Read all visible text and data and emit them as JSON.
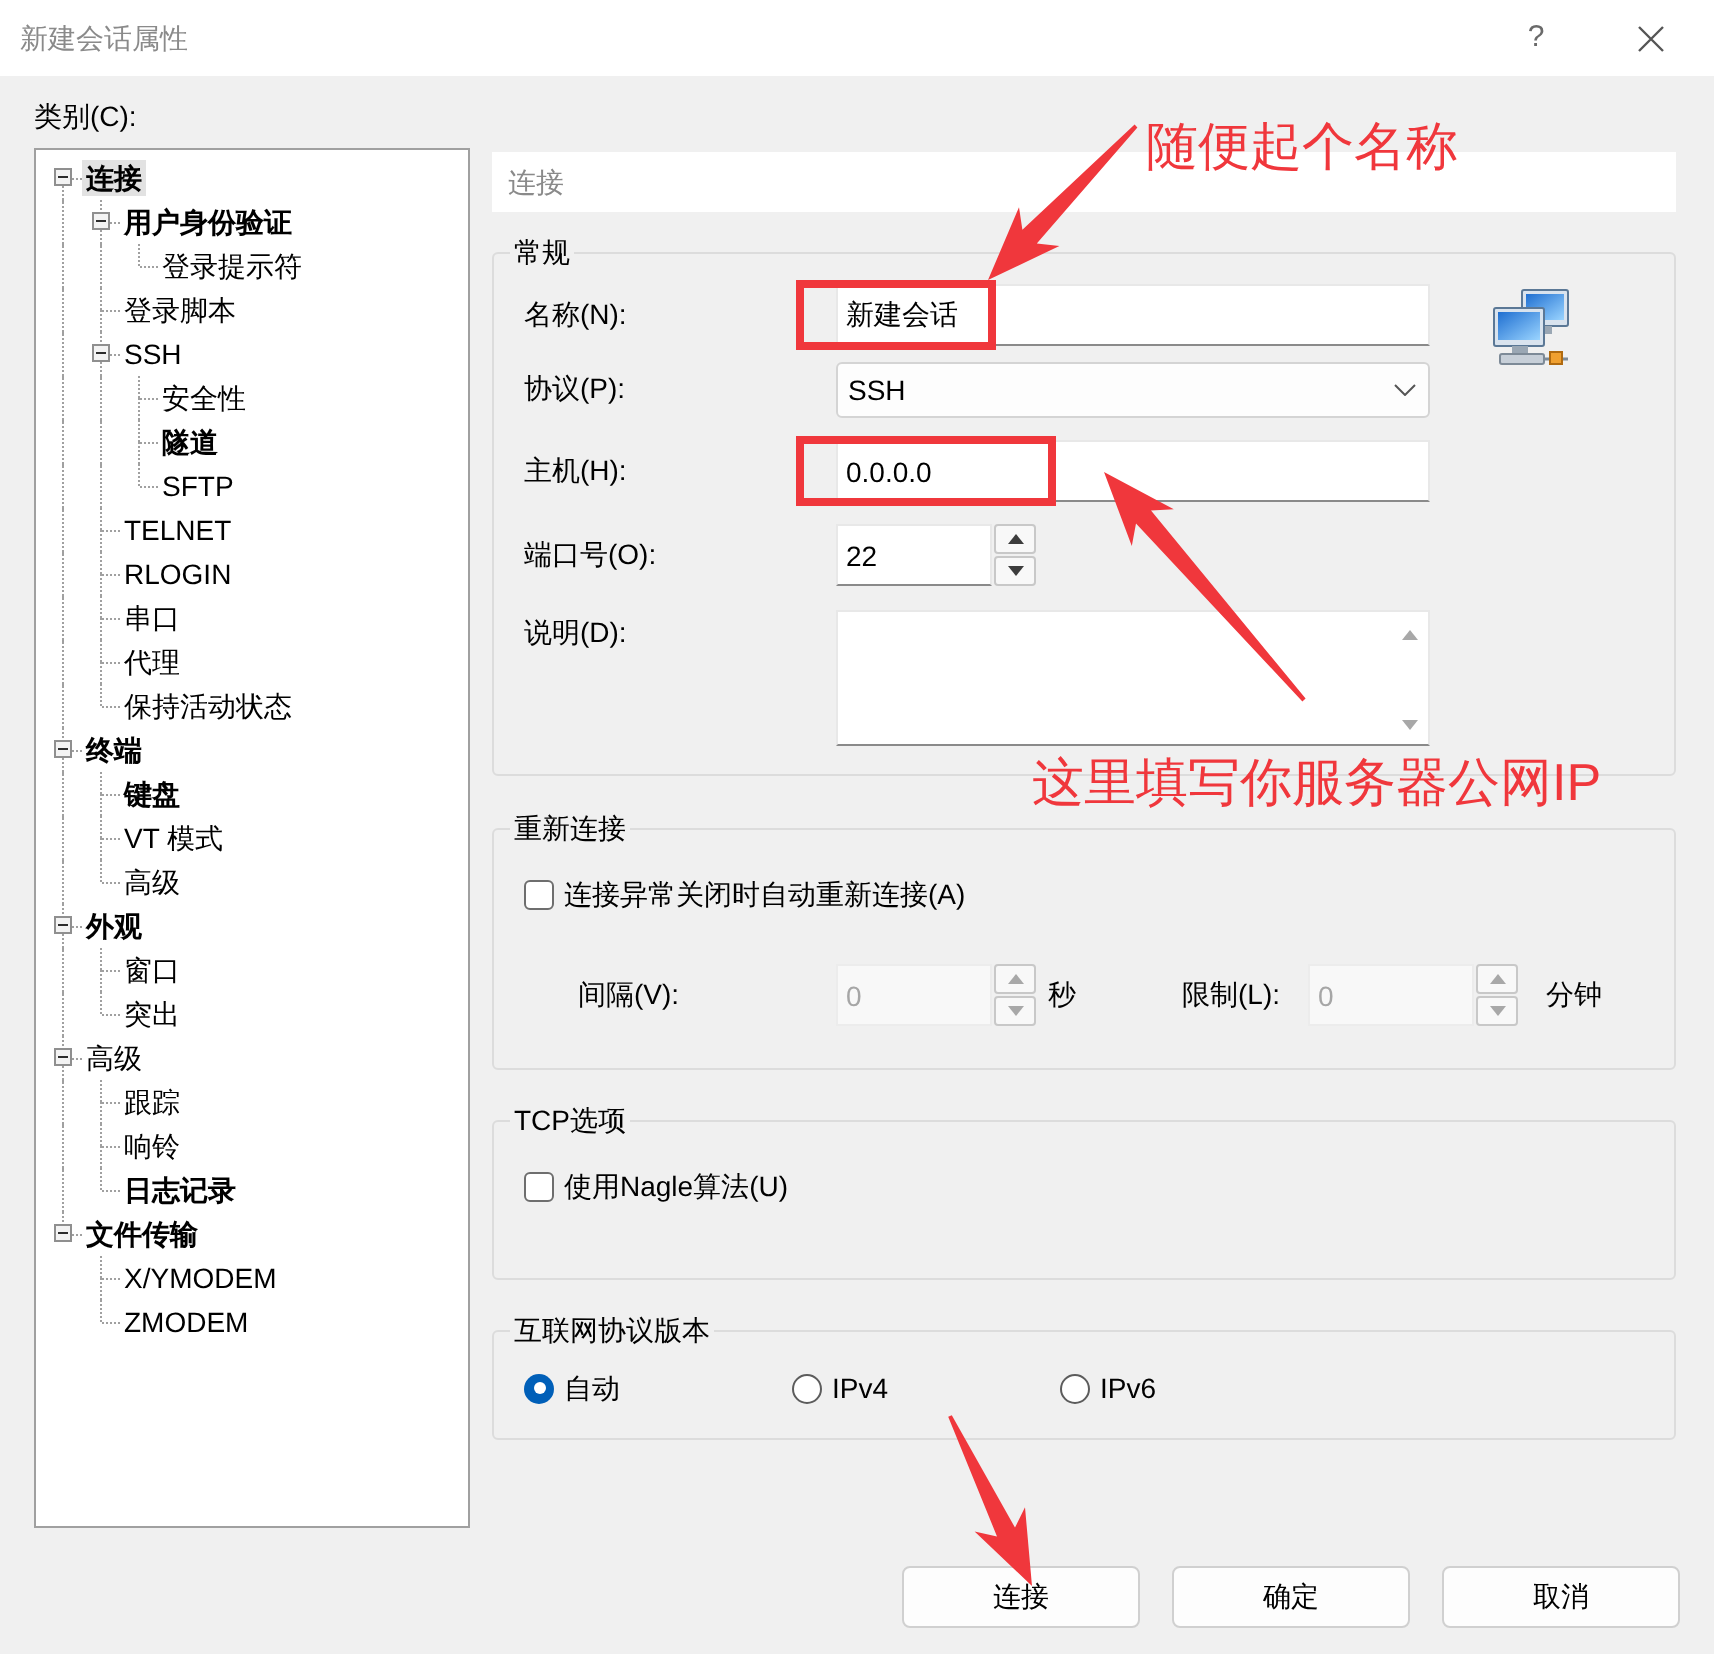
{
  "window": {
    "title": "新建会话属性",
    "help": "?"
  },
  "category_label": "类别(C):",
  "tree": [
    {
      "label": "连接",
      "bold": true,
      "selected": true,
      "expanded": true,
      "children": [
        {
          "label": "用户身份验证",
          "bold": true,
          "selected": false,
          "expanded": true,
          "children": [
            {
              "label": "登录提示符",
              "bold": false,
              "selected": false
            }
          ]
        },
        {
          "label": "登录脚本",
          "bold": false,
          "selected": false
        },
        {
          "label": "SSH",
          "bold": false,
          "selected": false,
          "expanded": true,
          "children": [
            {
              "label": "安全性",
              "bold": false,
              "selected": false
            },
            {
              "label": "隧道",
              "bold": true,
              "selected": false
            },
            {
              "label": "SFTP",
              "bold": false,
              "selected": false
            }
          ]
        },
        {
          "label": "TELNET",
          "bold": false,
          "selected": false
        },
        {
          "label": "RLOGIN",
          "bold": false,
          "selected": false
        },
        {
          "label": "串口",
          "bold": false,
          "selected": false
        },
        {
          "label": "代理",
          "bold": false,
          "selected": false
        },
        {
          "label": "保持活动状态",
          "bold": false,
          "selected": false
        }
      ]
    },
    {
      "label": "终端",
      "bold": true,
      "selected": false,
      "expanded": true,
      "children": [
        {
          "label": "键盘",
          "bold": true,
          "selected": false
        },
        {
          "label": "VT 模式",
          "bold": false,
          "selected": false
        },
        {
          "label": "高级",
          "bold": false,
          "selected": false
        }
      ]
    },
    {
      "label": "外观",
      "bold": true,
      "selected": false,
      "expanded": true,
      "children": [
        {
          "label": "窗口",
          "bold": false,
          "selected": false
        },
        {
          "label": "突出",
          "bold": false,
          "selected": false
        }
      ]
    },
    {
      "label": "高级",
      "bold": false,
      "selected": false,
      "expanded": true,
      "children": [
        {
          "label": "跟踪",
          "bold": false,
          "selected": false
        },
        {
          "label": "响铃",
          "bold": false,
          "selected": false
        },
        {
          "label": "日志记录",
          "bold": true,
          "selected": false
        }
      ]
    },
    {
      "label": "文件传输",
      "bold": true,
      "selected": false,
      "expanded": true,
      "children": [
        {
          "label": "X/YMODEM",
          "bold": false,
          "selected": false
        },
        {
          "label": "ZMODEM",
          "bold": false,
          "selected": false
        }
      ]
    }
  ],
  "section_header": "连接",
  "general": {
    "title": "常规",
    "fields": [
      {
        "kind": "text",
        "label": "名称(N):",
        "value": "新建会话",
        "highlighted": true
      },
      {
        "kind": "select",
        "label": "协议(P):",
        "value": "SSH",
        "highlighted": false
      },
      {
        "kind": "text",
        "label": "主机(H):",
        "value": "0.0.0.0",
        "highlighted": true
      },
      {
        "kind": "spin",
        "label": "端口号(O):",
        "value": "22",
        "highlighted": false
      },
      {
        "kind": "textarea",
        "label": "说明(D):",
        "highlighted": false
      }
    ]
  },
  "reconnect": {
    "title": "重新连接",
    "checkbox": {
      "label": "连接异常关闭时自动重新连接(A)",
      "checked": false
    },
    "spins": [
      {
        "label": "间隔(V):",
        "value": "0",
        "unit": "秒",
        "disabled": true
      },
      {
        "label": "限制(L):",
        "value": "0",
        "unit": "分钟",
        "disabled": true
      }
    ]
  },
  "tcp": {
    "title": "TCP选项",
    "checkbox": {
      "label": "使用Nagle算法(U)",
      "checked": false
    }
  },
  "ip_version": {
    "title": "互联网协议版本",
    "options": [
      {
        "label": "自动",
        "selected": true
      },
      {
        "label": "IPv4",
        "selected": false
      },
      {
        "label": "IPv6",
        "selected": false
      }
    ]
  },
  "buttons": [
    {
      "label": "连接"
    },
    {
      "label": "确定"
    },
    {
      "label": "取消"
    }
  ],
  "annotations": [
    {
      "text": "随便起个名称"
    },
    {
      "text": "这里填写你服务器公网IP"
    }
  ]
}
